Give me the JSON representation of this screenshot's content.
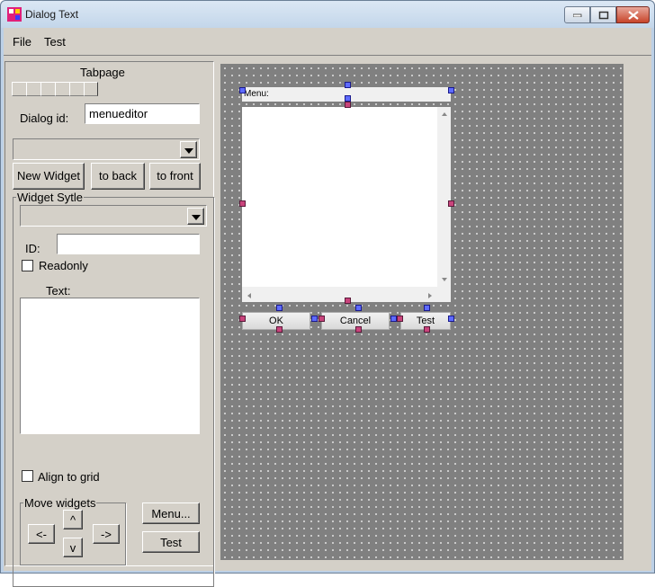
{
  "window": {
    "title": "Dialog Text"
  },
  "menubar": {
    "items": [
      "File",
      "Test"
    ]
  },
  "left_panel": {
    "tabpage_label": "Tabpage",
    "dialog_id_label": "Dialog id:",
    "dialog_id_value": "menueditor",
    "widget_select_value": "",
    "buttons": {
      "new_widget": "New Widget",
      "to_back": "to back",
      "to_front": "to front"
    },
    "widget_style": {
      "group_title": "Widget Sytle",
      "style_select_value": "",
      "id_label": "ID:",
      "id_value": "",
      "readonly_label": "Readonly",
      "readonly_checked": false,
      "text_label": "Text:",
      "text_value": ""
    },
    "align_to_grid_label": "Align to grid",
    "align_to_grid_checked": false,
    "move_widgets": {
      "group_title": "Move widgets",
      "up": "^",
      "left": "<-",
      "right": "->",
      "down": "v"
    },
    "menu_button": "Menu...",
    "test_button": "Test"
  },
  "canvas": {
    "menu_bar_text": "Menu:",
    "buttons": [
      "OK",
      "Cancel",
      "Test"
    ]
  },
  "colors": {
    "canvas_bg": "#808080",
    "handle_blue": "#5e6bff",
    "handle_pink": "#c9447c"
  }
}
